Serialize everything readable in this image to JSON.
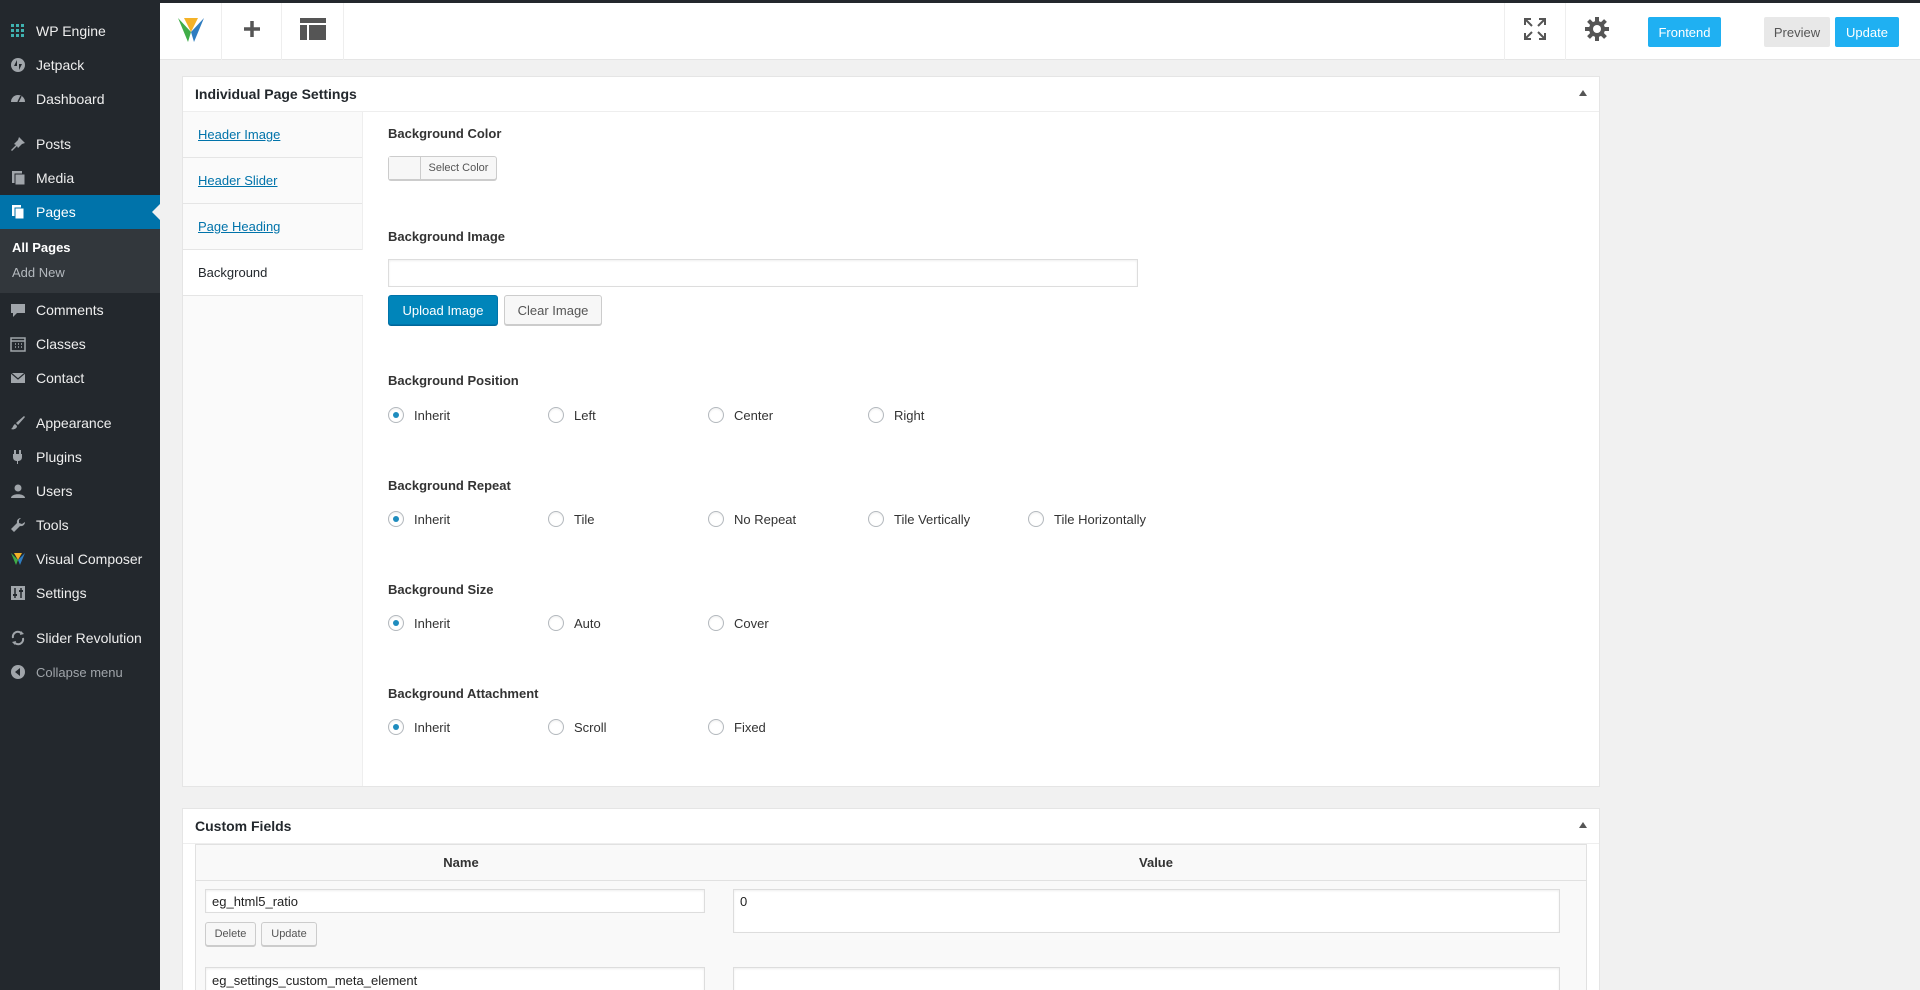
{
  "sidebar": {
    "items": [
      {
        "label": "WP Engine",
        "icon": "wp-engine-icon"
      },
      {
        "label": "Jetpack",
        "icon": "jetpack-icon"
      },
      {
        "label": "Dashboard",
        "icon": "dashboard-icon"
      },
      {
        "label": "Posts",
        "icon": "pushpin-icon"
      },
      {
        "label": "Media",
        "icon": "media-icon"
      },
      {
        "label": "Pages",
        "icon": "pages-icon"
      },
      {
        "label": "Comments",
        "icon": "comment-icon"
      },
      {
        "label": "Classes",
        "icon": "calendar-icon"
      },
      {
        "label": "Contact",
        "icon": "envelope-icon"
      },
      {
        "label": "Appearance",
        "icon": "paintbrush-icon"
      },
      {
        "label": "Plugins",
        "icon": "plug-icon"
      },
      {
        "label": "Users",
        "icon": "user-icon"
      },
      {
        "label": "Tools",
        "icon": "wrench-icon"
      },
      {
        "label": "Visual Composer",
        "icon": "visual-composer-icon"
      },
      {
        "label": "Settings",
        "icon": "settings-sliders-icon"
      },
      {
        "label": "Slider Revolution",
        "icon": "refresh-icon"
      },
      {
        "label": "Collapse menu",
        "icon": "collapse-icon"
      }
    ],
    "submenu": {
      "all_pages": "All Pages",
      "add_new": "Add New"
    }
  },
  "toolbar": {
    "frontend": "Frontend",
    "preview": "Preview",
    "update": "Update"
  },
  "page_settings": {
    "title": "Individual Page Settings",
    "tabs": [
      "Header Image",
      "Header Slider",
      "Page Heading",
      "Background"
    ],
    "bg_color": {
      "label": "Background Color",
      "button": "Select Color"
    },
    "bg_image": {
      "label": "Background Image",
      "value": "",
      "upload": "Upload Image",
      "clear": "Clear Image"
    },
    "bg_position": {
      "label": "Background Position",
      "options": [
        "Inherit",
        "Left",
        "Center",
        "Right"
      ],
      "selected": "Inherit"
    },
    "bg_repeat": {
      "label": "Background Repeat",
      "options": [
        "Inherit",
        "Tile",
        "No Repeat",
        "Tile Vertically",
        "Tile Horizontally"
      ],
      "selected": "Inherit"
    },
    "bg_size": {
      "label": "Background Size",
      "options": [
        "Inherit",
        "Auto",
        "Cover"
      ],
      "selected": "Inherit"
    },
    "bg_attachment": {
      "label": "Background Attachment",
      "options": [
        "Inherit",
        "Scroll",
        "Fixed"
      ],
      "selected": "Inherit"
    }
  },
  "custom_fields": {
    "title": "Custom Fields",
    "col_name": "Name",
    "col_value": "Value",
    "rows": [
      {
        "name": "eg_html5_ratio",
        "value": "0"
      },
      {
        "name": "eg_settings_custom_meta_element",
        "value": ""
      }
    ],
    "delete": "Delete",
    "update": "Update"
  },
  "colors": {
    "accent": "#0073aa",
    "frontend_btn": "#1fb0f2",
    "sidebar_bg": "#23282d"
  }
}
